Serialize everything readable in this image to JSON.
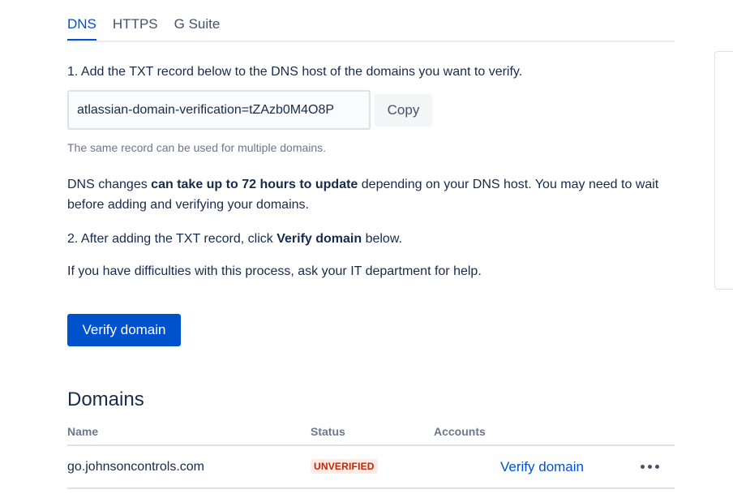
{
  "tabs": [
    {
      "label": "DNS",
      "active": true
    },
    {
      "label": "HTTPS",
      "active": false
    },
    {
      "label": "G Suite",
      "active": false
    }
  ],
  "instructions": {
    "step1": "1. Add the TXT record below to the DNS host of the domains you want to verify.",
    "record_value": "atlassian-domain-verification=tZAzb0M4O8P",
    "copy_label": "Copy",
    "helper": "The same record can be used for multiple domains.",
    "dns_note_pre": "DNS changes ",
    "dns_note_bold": "can take up to 72 hours to update",
    "dns_note_post": " depending on your DNS host. You may need to wait before adding and verifying your domains.",
    "step2_pre": "2. After adding the TXT record, click ",
    "step2_bold": "Verify domain",
    "step2_post": " below.",
    "difficulty": "If you have difficulties with this process, ask your IT department for help.",
    "verify_button": "Verify domain"
  },
  "domains": {
    "title": "Domains",
    "columns": [
      "Name",
      "Status",
      "Accounts"
    ],
    "rows": [
      {
        "name": "go.johnsoncontrols.com",
        "status": "UNVERIFIED",
        "accounts": "",
        "action": "Verify domain"
      }
    ]
  },
  "colors": {
    "primary": "#0052cc",
    "unverified_bg": "#ffebe6",
    "unverified_text": "#bf2600",
    "text": "#172b4d",
    "subtle": "#6b778c"
  },
  "icons": {
    "more": "more-horizontal-icon"
  }
}
